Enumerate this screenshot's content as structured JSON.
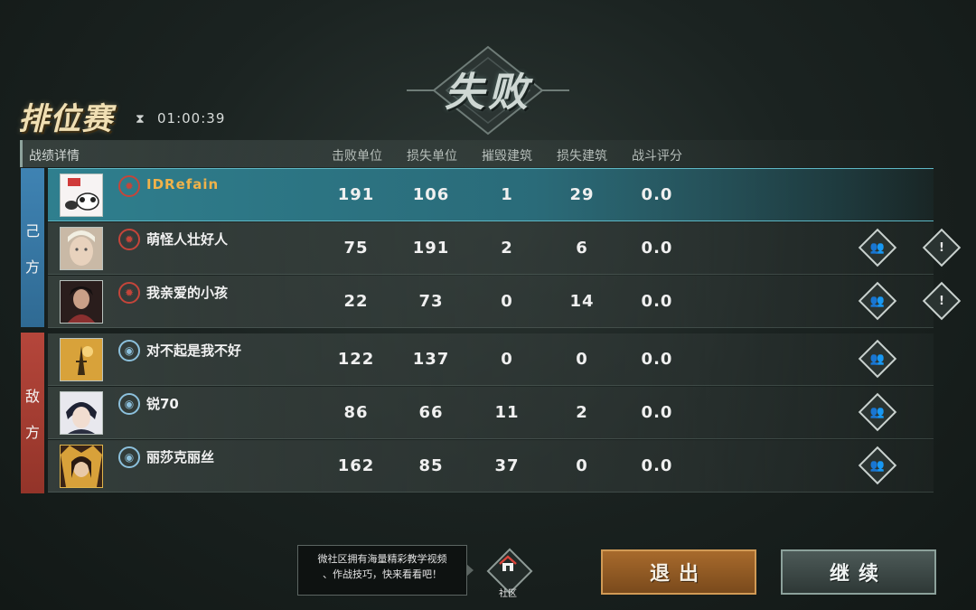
{
  "result": {
    "title": "失败"
  },
  "mode": {
    "title": "排位赛",
    "timer": "01:00:39",
    "timer_icon": "hourglass-icon"
  },
  "header": {
    "label": "战绩详情",
    "columns": [
      "击败单位",
      "损失单位",
      "摧毁建筑",
      "损失建筑",
      "战斗评分"
    ]
  },
  "sides": {
    "own": "己方",
    "enemy": "敌方"
  },
  "players": [
    {
      "name": "IDRefain",
      "team": "own",
      "is_self": true,
      "stats": [
        "191",
        "106",
        "1",
        "29",
        "0.0"
      ]
    },
    {
      "name": "萌怪人壮好人",
      "team": "own",
      "is_self": false,
      "stats": [
        "75",
        "191",
        "2",
        "6",
        "0.0"
      ]
    },
    {
      "name": "我亲爱的小孩",
      "team": "own",
      "is_self": false,
      "stats": [
        "22",
        "73",
        "0",
        "14",
        "0.0"
      ]
    },
    {
      "name": "对不起是我不好",
      "team": "enemy",
      "is_self": false,
      "stats": [
        "122",
        "137",
        "0",
        "0",
        "0.0"
      ]
    },
    {
      "name": "锐70",
      "team": "enemy",
      "is_self": false,
      "stats": [
        "86",
        "66",
        "11",
        "2",
        "0.0"
      ]
    },
    {
      "name": "丽莎克丽丝",
      "team": "enemy",
      "is_self": false,
      "stats": [
        "162",
        "85",
        "37",
        "0",
        "0.0"
      ]
    }
  ],
  "tip": {
    "line1": "微社区拥有海量精彩教学视频",
    "line2": "、作战技巧，快来看看吧！"
  },
  "community": {
    "label": "社区",
    "icon": "home-icon"
  },
  "buttons": {
    "exit": "退出",
    "continue": "继续"
  },
  "colors": {
    "own": "#3f83b3",
    "enemy": "#b5463b",
    "self_name": "#f0b24a",
    "highlight": "#2f7f8e"
  }
}
